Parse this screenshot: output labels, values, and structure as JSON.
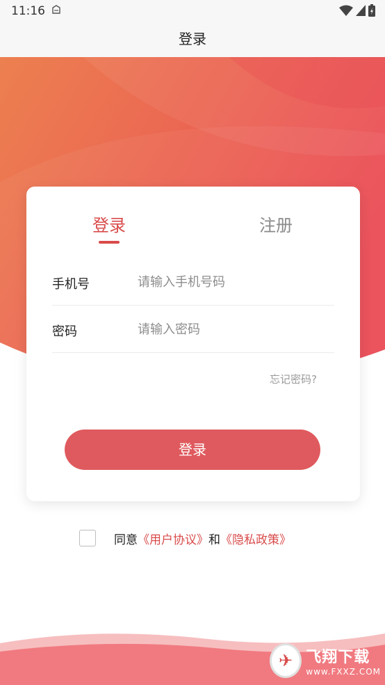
{
  "status_bar": {
    "time": "11:16"
  },
  "header": {
    "title": "登录"
  },
  "tabs": {
    "login": "登录",
    "register": "注册"
  },
  "form": {
    "phone_label": "手机号",
    "phone_placeholder": "请输入手机号码",
    "password_label": "密码",
    "password_placeholder": "请输入密码",
    "forgot_link": "忘记密码?",
    "submit_label": "登录"
  },
  "agreement": {
    "prefix": "同意",
    "user_agreement": "《用户协议》",
    "connector": "和",
    "privacy_policy": "《隐私政策》",
    "checked": false
  },
  "watermark": {
    "title": "飞翔下载",
    "site": "www.FXXZ.COM"
  },
  "colors": {
    "accent": "#d94b4b",
    "button": "#df5a5e",
    "hero_start": "#ec8050",
    "hero_end": "#ea4a55"
  }
}
